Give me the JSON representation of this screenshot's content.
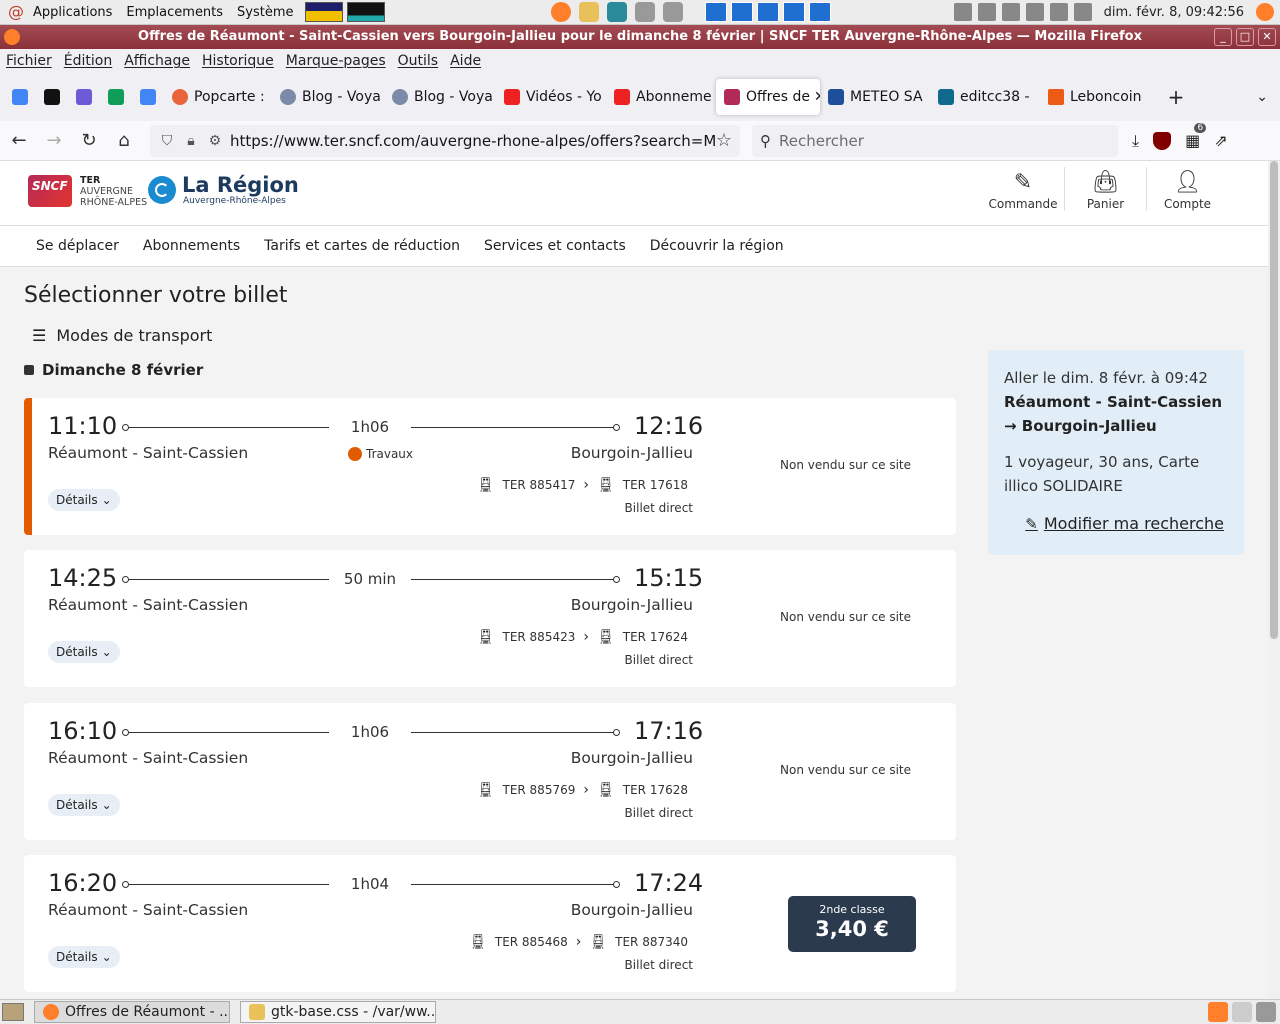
{
  "top_panel": {
    "menus": [
      "Applications",
      "Emplacements",
      "Système"
    ],
    "clock": "dim. févr.  8, 09:42:56"
  },
  "window": {
    "title": "Offres de Réaumont - Saint-Cassien vers Bourgoin-Jallieu pour le dimanche 8 février | SNCF TER Auvergne-Rhône-Alpes — Mozilla Firefox"
  },
  "menubar": [
    "Fichier",
    "Édition",
    "Affichage",
    "Historique",
    "Marque-pages",
    "Outils",
    "Aide"
  ],
  "tabs": [
    {
      "label": "Popcarte :",
      "color": "#e8643a"
    },
    {
      "label": "Blog - Voya",
      "color": "#7b8aa8"
    },
    {
      "label": "Blog - Voya",
      "color": "#7b8aa8"
    },
    {
      "label": "Vidéos - Yo",
      "color": "#e22"
    },
    {
      "label": "Abonneme",
      "color": "#e22"
    },
    {
      "label": "Offres de",
      "color": "#b22a58",
      "active": true
    },
    {
      "label": "METEO SA",
      "color": "#1d4f9a"
    },
    {
      "label": "editcc38 -",
      "color": "#0f6a8e"
    },
    {
      "label": "Leboncoin",
      "color": "#ec5a13"
    }
  ],
  "navbar": {
    "url": "https://www.ter.sncf.com/auvergne-rhone-alpes/offers?search=M",
    "search_placeholder": "Rechercher",
    "ext_badge": "6"
  },
  "site": {
    "ter_line1": "TER",
    "ter_line2": "AUVERGNE",
    "ter_line3": "RHÔNE-ALPES",
    "region_title": "La Région",
    "region_sub": "Auvergne-Rhône-Alpes",
    "actions": {
      "order": "Commande",
      "cart": "Panier",
      "account": "Compte"
    },
    "nav": [
      "Se déplacer",
      "Abonnements",
      "Tarifs et cartes de réduction",
      "Services et contacts",
      "Découvrir la région"
    ]
  },
  "content": {
    "title": "Sélectionner votre billet",
    "modes": "Modes de transport",
    "date": "Dimanche 8 février",
    "details_label": "Détails",
    "direct_label": "Billet direct",
    "not_sold_label": "Non vendu sur ce site"
  },
  "journeys": [
    {
      "dep_time": "11:10",
      "arr_time": "12:16",
      "duration": "1h06",
      "dep_station": "Réaumont - Saint-Cassien",
      "arr_station": "Bourgoin-Jallieu",
      "train1": "TER 885417",
      "train2": "TER 17618",
      "works": "Travaux"
    },
    {
      "dep_time": "14:25",
      "arr_time": "15:15",
      "duration": "50 min",
      "dep_station": "Réaumont - Saint-Cassien",
      "arr_station": "Bourgoin-Jallieu",
      "train1": "TER 885423",
      "train2": "TER 17624"
    },
    {
      "dep_time": "16:10",
      "arr_time": "17:16",
      "duration": "1h06",
      "dep_station": "Réaumont - Saint-Cassien",
      "arr_station": "Bourgoin-Jallieu",
      "train1": "TER 885769",
      "train2": "TER 17628"
    },
    {
      "dep_time": "16:20",
      "arr_time": "17:24",
      "duration": "1h04",
      "dep_station": "Réaumont - Saint-Cassien",
      "arr_station": "Bourgoin-Jallieu",
      "train1": "TER 885468",
      "train2": "TER 887340",
      "price_class": "2nde classe",
      "price": "3,40 €"
    }
  ],
  "summary": {
    "line1": "Aller le dim. 8 févr. à 09:42",
    "route": "Réaumont - Saint-Cassien → Bourgoin-Jallieu",
    "traveler": "1 voyageur, 30 ans, Carte illico SOLIDAIRE",
    "modify": "Modifier ma recherche"
  },
  "taskbar": {
    "task1": "Offres de Réaumont - ...",
    "task2": "gtk-base.css - /var/ww..."
  },
  "colors": {
    "accent_alert": "#e15b00",
    "price_bg": "#2c3a4d",
    "summary_bg": "#e1eef7",
    "titlebar": "#8a3038"
  }
}
